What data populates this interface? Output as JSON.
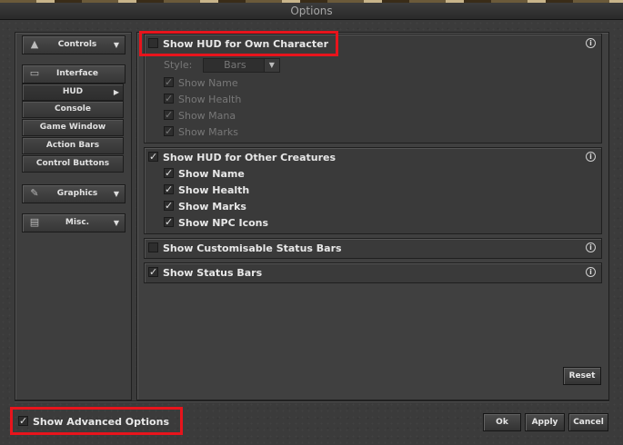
{
  "window": {
    "title": "Options"
  },
  "sidebar": {
    "groups": [
      {
        "label": "Controls",
        "icon": "controls-icon"
      },
      {
        "label": "Interface",
        "icon": "interface-icon"
      },
      {
        "label": "Graphics",
        "icon": "brush-icon"
      },
      {
        "label": "Misc.",
        "icon": "document-icon"
      }
    ],
    "interface_items": [
      "HUD",
      "Console",
      "Game Window",
      "Action Bars",
      "Control Buttons"
    ],
    "selected": "HUD"
  },
  "sections": {
    "own": {
      "title": "Show HUD for Own Character",
      "checked": false,
      "style_label": "Style:",
      "style_value": "Bars",
      "items": [
        "Show Name",
        "Show Health",
        "Show Mana",
        "Show Marks"
      ]
    },
    "others": {
      "title": "Show HUD for Other Creatures",
      "checked": true,
      "items": [
        "Show Name",
        "Show Health",
        "Show Marks",
        "Show NPC Icons"
      ]
    },
    "custom_status": {
      "title": "Show Customisable Status Bars",
      "checked": false
    },
    "status": {
      "title": "Show Status Bars",
      "checked": true
    },
    "info_glyph": "i"
  },
  "buttons": {
    "reset": "Reset",
    "ok": "Ok",
    "apply": "Apply",
    "cancel": "Cancel"
  },
  "advanced": {
    "label": "Show Advanced Options",
    "checked": true
  },
  "colors": {
    "highlight": "#e8141c",
    "panel": "#3b3b3b"
  }
}
